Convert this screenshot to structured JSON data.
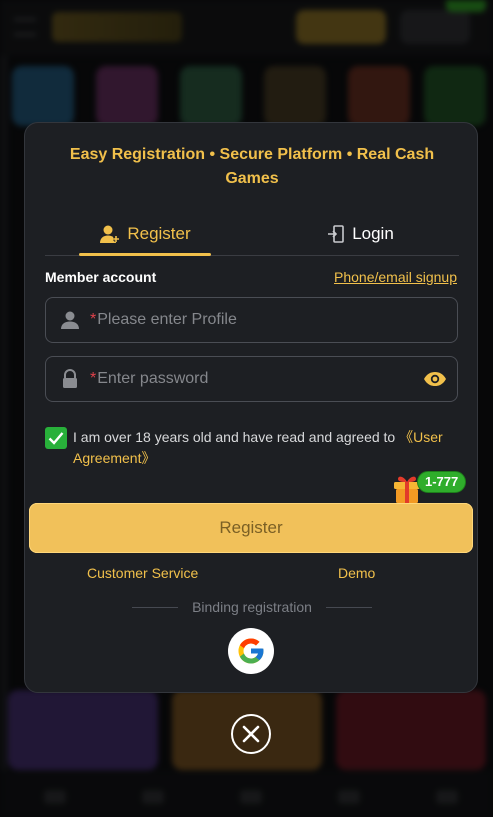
{
  "promo": {
    "headline": "Easy Registration • Secure Platform • Real Cash Games"
  },
  "tabs": [
    {
      "label": "Register",
      "icon": "user-add-icon",
      "active": true
    },
    {
      "label": "Login",
      "icon": "login-door-icon",
      "active": false
    }
  ],
  "form": {
    "member_label": "Member account",
    "alt_signup_link": "Phone/email signup",
    "profile_field": {
      "required_mark": "*",
      "placeholder": "Please enter Profile",
      "value": "",
      "icon": "user-icon"
    },
    "password_field": {
      "required_mark": "*",
      "placeholder": "Enter password",
      "value": "",
      "icon": "lock-icon",
      "toggle_icon": "eye-icon"
    },
    "agreement": {
      "checked": true,
      "text": "I am over 18 years old and have read and agreed to ",
      "link": "《User Agreement》"
    },
    "gift_badge": "1-777",
    "submit_label": "Register"
  },
  "links": {
    "customer_service": "Customer Service",
    "demo": "Demo"
  },
  "binding": {
    "label": "Binding registration",
    "providers": [
      "google-icon"
    ]
  },
  "colors": {
    "accent": "#f1c04b",
    "modal_bg": "#1d1f23",
    "checkbox": "#28b03a",
    "badge": "#2fad2b",
    "required": "#e0424b"
  }
}
